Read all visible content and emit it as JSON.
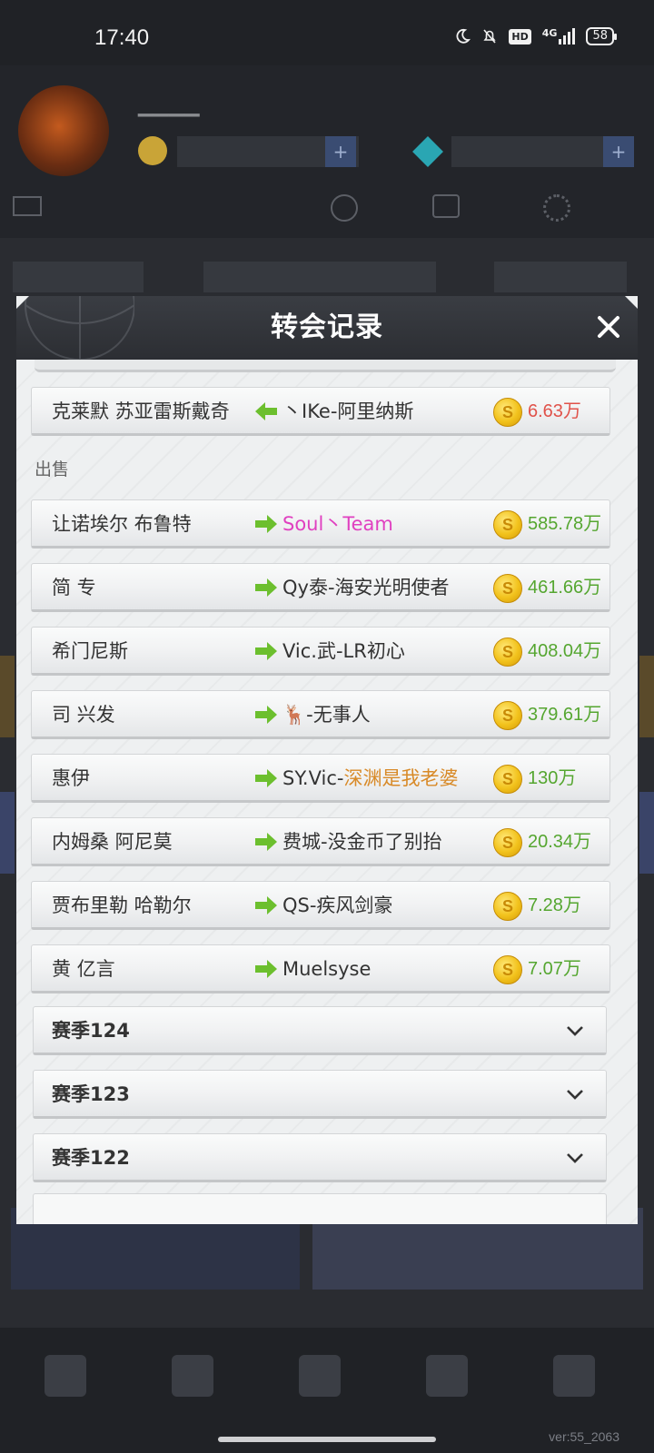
{
  "status_bar": {
    "time": "17:40",
    "hd": "HD",
    "network": "4G",
    "battery": "58"
  },
  "background": {
    "version": "ver:55_2063"
  },
  "modal": {
    "title": "转会记录",
    "close_icon": "close-icon",
    "buy_rows": [
      {
        "player": "克莱默 苏亚雷斯戴奇",
        "direction": "in",
        "team": "丶IKe-阿里纳斯",
        "price": "6.63万",
        "price_color": "#e0524a"
      }
    ],
    "sell_label": "出售",
    "sell_rows": [
      {
        "player": "让诺埃尔 布鲁特",
        "direction": "out",
        "team_parts": [
          {
            "text": "Soul丶Team",
            "style": "pink"
          }
        ],
        "price": "585.78万"
      },
      {
        "player": "简 专",
        "direction": "out",
        "team_parts": [
          {
            "text": "Qy泰-海安光明使者",
            "style": ""
          }
        ],
        "price": "461.66万"
      },
      {
        "player": "希门尼斯",
        "direction": "out",
        "team_parts": [
          {
            "text": "Vic.武-LR初心",
            "style": ""
          }
        ],
        "price": "408.04万"
      },
      {
        "player": "司 兴发",
        "direction": "out",
        "team_parts": [
          {
            "text": "🦌-无事人",
            "style": ""
          }
        ],
        "price": "379.61万"
      },
      {
        "player": "惠伊",
        "direction": "out",
        "team_parts": [
          {
            "text": "SY.Vic-",
            "style": ""
          },
          {
            "text": "深渊是我老婆",
            "style": "orange"
          }
        ],
        "price": "130万"
      },
      {
        "player": "内姆桑 阿尼莫",
        "direction": "out",
        "team_parts": [
          {
            "text": "费城-没金币了别抬",
            "style": ""
          }
        ],
        "price": "20.34万"
      },
      {
        "player": "贾布里勒 哈勒尔",
        "direction": "out",
        "team_parts": [
          {
            "text": "QS-疾风剑豪",
            "style": ""
          }
        ],
        "price": "7.28万"
      },
      {
        "player": "黄 亿言",
        "direction": "out",
        "team_parts": [
          {
            "text": "Muelsyse",
            "style": ""
          }
        ],
        "price": "7.07万"
      }
    ],
    "seasons": [
      {
        "label": "赛季124"
      },
      {
        "label": "赛季123"
      },
      {
        "label": "赛季122"
      }
    ],
    "colors": {
      "price_green": "#55a630",
      "arrow_green": "#6cbf2e",
      "pink": "#e040c0",
      "orange": "#d88a28"
    }
  }
}
